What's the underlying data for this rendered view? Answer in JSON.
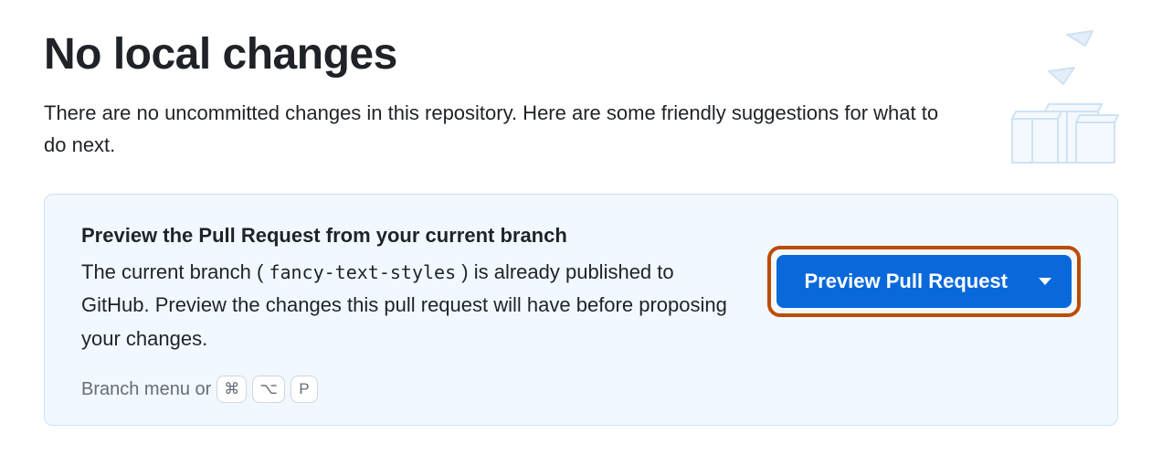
{
  "header": {
    "title": "No local changes",
    "subtitle": "There are no uncommitted changes in this repository. Here are some friendly suggestions for what to do next."
  },
  "card": {
    "title": "Preview the Pull Request from your current branch",
    "description_prefix": "The current branch (",
    "branch_name": "fancy-text-styles",
    "description_suffix": ") is already published to GitHub. Preview the changes this pull request will have before proposing your changes.",
    "button_label": "Preview Pull Request",
    "shortcut_label": "Branch menu or",
    "keys": [
      "⌘",
      "⌥",
      "P"
    ]
  }
}
